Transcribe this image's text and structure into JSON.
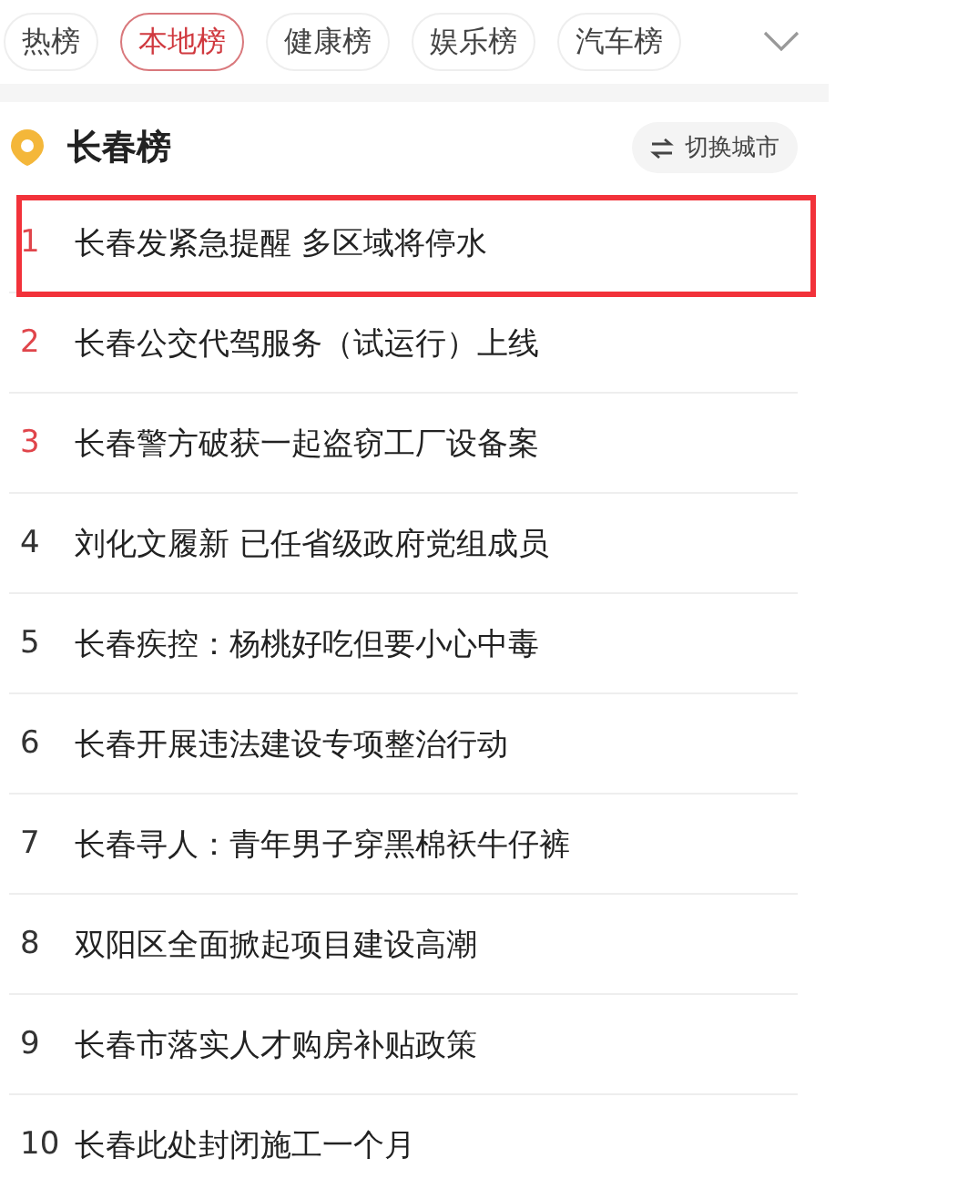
{
  "tabs": [
    {
      "label": "热榜",
      "selected": false
    },
    {
      "label": "本地榜",
      "selected": true
    },
    {
      "label": "健康榜",
      "selected": false
    },
    {
      "label": "娱乐榜",
      "selected": false
    },
    {
      "label": "汽车榜",
      "selected": false
    }
  ],
  "board": {
    "title": "长春榜",
    "switch_button": "切换城市"
  },
  "items": [
    {
      "rank": "1",
      "title": "长春发紧急提醒 多区域将停水",
      "top": true,
      "highlighted": true
    },
    {
      "rank": "2",
      "title": "长春公交代驾服务（试运行）上线",
      "top": true,
      "highlighted": false
    },
    {
      "rank": "3",
      "title": "长春警方破获一起盗窃工厂设备案",
      "top": true,
      "highlighted": false
    },
    {
      "rank": "4",
      "title": "刘化文履新 已任省级政府党组成员",
      "top": false,
      "highlighted": false
    },
    {
      "rank": "5",
      "title": "长春疾控：杨桃好吃但要小心中毒",
      "top": false,
      "highlighted": false
    },
    {
      "rank": "6",
      "title": "长春开展违法建设专项整治行动",
      "top": false,
      "highlighted": false
    },
    {
      "rank": "7",
      "title": "长春寻人：青年男子穿黑棉袄牛仔裤",
      "top": false,
      "highlighted": false
    },
    {
      "rank": "8",
      "title": "双阳区全面掀起项目建设高潮",
      "top": false,
      "highlighted": false
    },
    {
      "rank": "9",
      "title": "长春市落实人才购房补贴政策",
      "top": false,
      "highlighted": false
    },
    {
      "rank": "10",
      "title": "长春此处封闭施工一个月",
      "top": false,
      "highlighted": false
    }
  ]
}
